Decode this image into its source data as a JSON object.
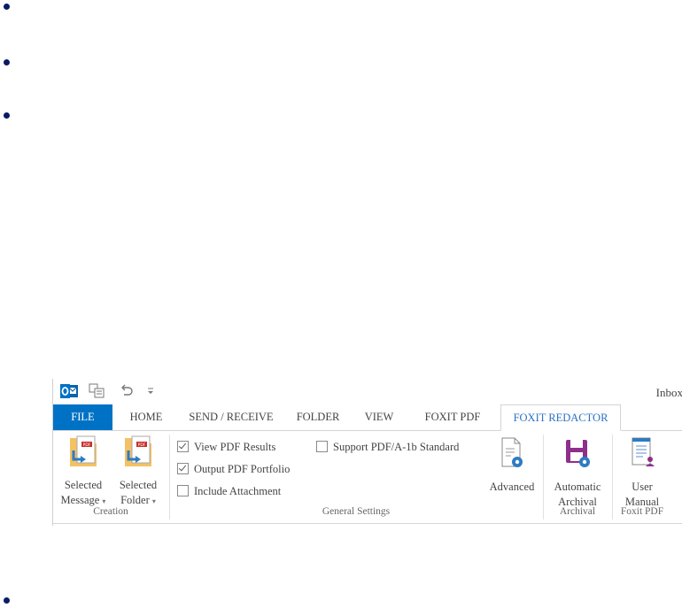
{
  "qat": {
    "outlook_icon": "outlook-icon",
    "send_receive_icon": "send-receive-all-icon",
    "undo_icon": "undo-icon",
    "customize_icon": "customize-qat-icon",
    "window_title": "Inbox"
  },
  "tabs": [
    {
      "label": "FILE"
    },
    {
      "label": "HOME"
    },
    {
      "label": "SEND / RECEIVE"
    },
    {
      "label": "FOLDER"
    },
    {
      "label": "VIEW"
    },
    {
      "label": "FOXIT PDF"
    },
    {
      "label": "FOXIT REDACTOR"
    }
  ],
  "groups": {
    "creation": {
      "label": "Creation",
      "selected_message": {
        "line1": "Selected",
        "line2": "Message",
        "icon": "pdf-message-icon"
      },
      "selected_folder": {
        "line1": "Selected",
        "line2": "Folder",
        "icon": "pdf-folder-icon"
      }
    },
    "general_settings": {
      "label": "General Settings",
      "view_pdf_results": {
        "label": "View PDF Results",
        "checked": true
      },
      "output_pdf_portfolio": {
        "label": "Output PDF Portfolio",
        "checked": true
      },
      "include_attachment": {
        "label": "Include Attachment",
        "checked": false
      },
      "support_pdfa": {
        "label": "Support PDF/A-1b Standard",
        "checked": false
      },
      "advanced": {
        "label": "Advanced",
        "icon": "settings-document-icon"
      }
    },
    "archival": {
      "label": "Archival",
      "automatic_archival": {
        "line1": "Automatic",
        "line2": "Archival",
        "icon": "save-gear-icon"
      }
    },
    "foxit_pdf": {
      "label": "Foxit PDF",
      "user_manual": {
        "line1": "User",
        "line2": "Manual",
        "icon": "user-manual-icon"
      }
    }
  },
  "colors": {
    "file_tab": "#0072c6",
    "active_tab_text": "#2b72c4",
    "bullet": "#0b1a66"
  }
}
